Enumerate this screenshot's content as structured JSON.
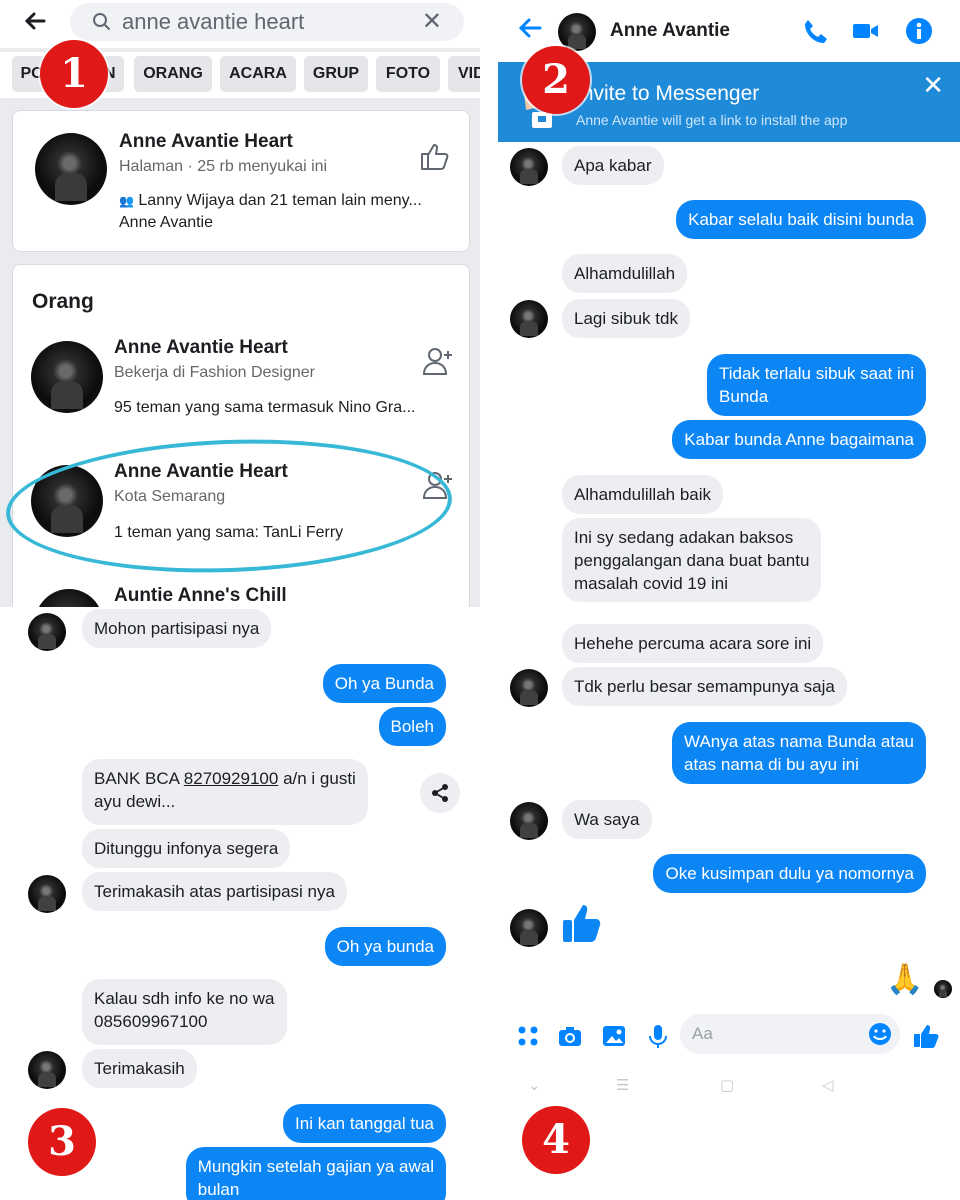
{
  "search": {
    "query": "anne avantie heart",
    "filters": [
      "POSTINGAN",
      "ORANG",
      "ACARA",
      "GRUP",
      "FOTO",
      "VIDEO"
    ]
  },
  "page_result": {
    "name": "Anne Avantie Heart",
    "subtitle": "Halaman · 25 rb menyukai ini",
    "social_line1": "Lanny Wijaya dan 21 teman lain meny...",
    "social_line2": "Anne Avantie"
  },
  "people": {
    "title": "Orang",
    "items": [
      {
        "name": "Anne Avantie Heart",
        "detail": "Bekerja di Fashion Designer",
        "mutual": "95 teman yang sama termasuk Nino Gra..."
      },
      {
        "name": "Anne Avantie Heart",
        "detail": "Kota Semarang",
        "mutual": "1 teman yang sama: TanLi Ferry"
      },
      {
        "name": "Auntie Anne's Chill"
      }
    ]
  },
  "chat2": {
    "contact": "Anne Avantie",
    "invite_title": "Invite to Messenger",
    "invite_sub": "Anne Avantie will get a link to install the app",
    "messages": [
      "Apa kabar",
      "Kabar selalu baik disini bunda",
      "Alhamdulillah",
      "Lagi sibuk tdk",
      "Tidak terlalu sibuk saat ini",
      "Bunda",
      "Kabar bunda Anne bagaimana",
      "Alhamdulillah baik",
      "Ini sy sedang adakan baksos",
      "penggalangan dana buat bantu",
      "masalah covid 19 ini",
      "Hehehe percuma acara sore ini",
      "Tdk perlu besar semampunya saja",
      "WAnya atas nama Bunda atau",
      "atas nama di bu ayu ini",
      "Wa saya",
      "Oke kusimpan dulu ya nomornya"
    ],
    "composer_placeholder": "Aa"
  },
  "chat3": {
    "messages": [
      "Mohon partisipasi nya",
      "Oh ya Bunda",
      "Boleh",
      "BANK BCA",
      "8270929100",
      "a/n i gusti",
      "ayu dewi...",
      "Ditunggu infonya segera",
      "Terimakasih atas partisipasi nya",
      "Oh ya bunda",
      "Kalau sdh info ke no wa",
      "085609967100",
      "Terimakasih",
      "Ini kan tanggal tua",
      "Mungkin setelah gajian ya awal",
      "bulan"
    ]
  },
  "labels": [
    "1",
    "2",
    "3",
    "4"
  ],
  "colors": {
    "messenger_blue": "#0d86f5",
    "annotation_circle": "#36b8d6",
    "badge_red": "#e01818"
  }
}
